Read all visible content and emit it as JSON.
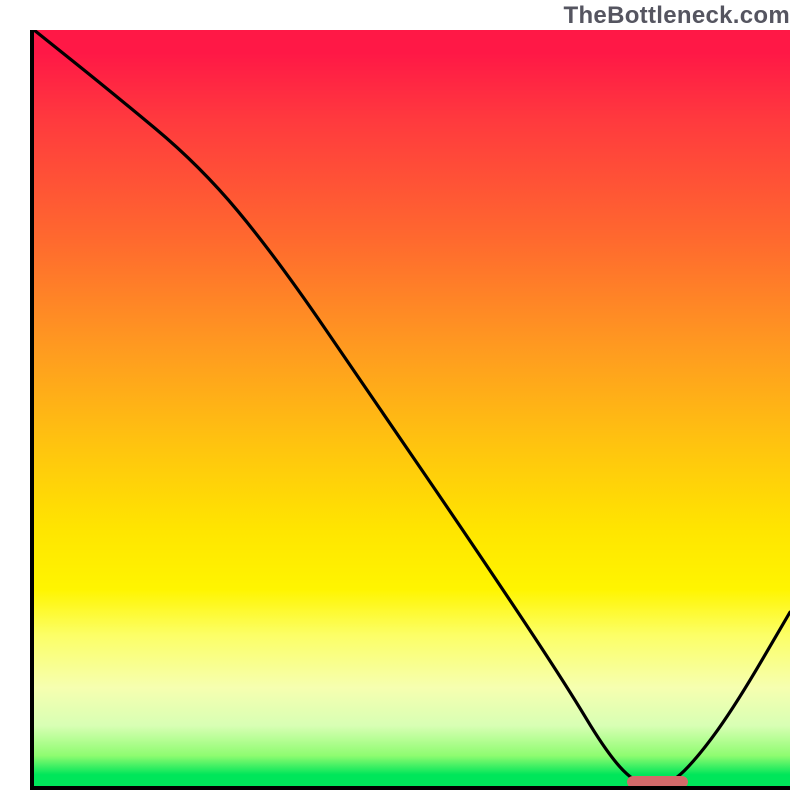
{
  "watermark": "TheBottleneck.com",
  "colors": {
    "gradient_top": "#ff1846",
    "gradient_mid1": "#ff9a20",
    "gradient_mid2": "#ffe500",
    "gradient_bottom": "#00e65a",
    "axis": "#000000",
    "curve": "#000000",
    "marker": "#d36a6a"
  },
  "chart_data": {
    "type": "line",
    "title": "",
    "xlabel": "",
    "ylabel": "",
    "xlim": [
      0,
      100
    ],
    "ylim": [
      0,
      100
    ],
    "annotations": [],
    "series": [
      {
        "name": "bottleneck-curve",
        "x": [
          0,
          10,
          22,
          32,
          45,
          58,
          70,
          76,
          80,
          84,
          88,
          93,
          100
        ],
        "y": [
          100,
          92,
          82,
          70,
          51,
          32,
          14,
          4,
          0,
          0,
          4,
          11,
          23
        ]
      }
    ],
    "marker": {
      "name": "optimal-range-marker",
      "x_start": 78,
      "x_end": 86,
      "y": 0
    },
    "background": {
      "type": "vertical-gradient",
      "meaning": "red=high bottleneck, green=low bottleneck",
      "stops": [
        {
          "pos": 0.0,
          "color": "#ff1846"
        },
        {
          "pos": 0.28,
          "color": "#ff6a2e"
        },
        {
          "pos": 0.55,
          "color": "#ffc40f"
        },
        {
          "pos": 0.74,
          "color": "#fff500"
        },
        {
          "pos": 0.92,
          "color": "#d8ffb4"
        },
        {
          "pos": 1.0,
          "color": "#00e65a"
        }
      ]
    }
  }
}
